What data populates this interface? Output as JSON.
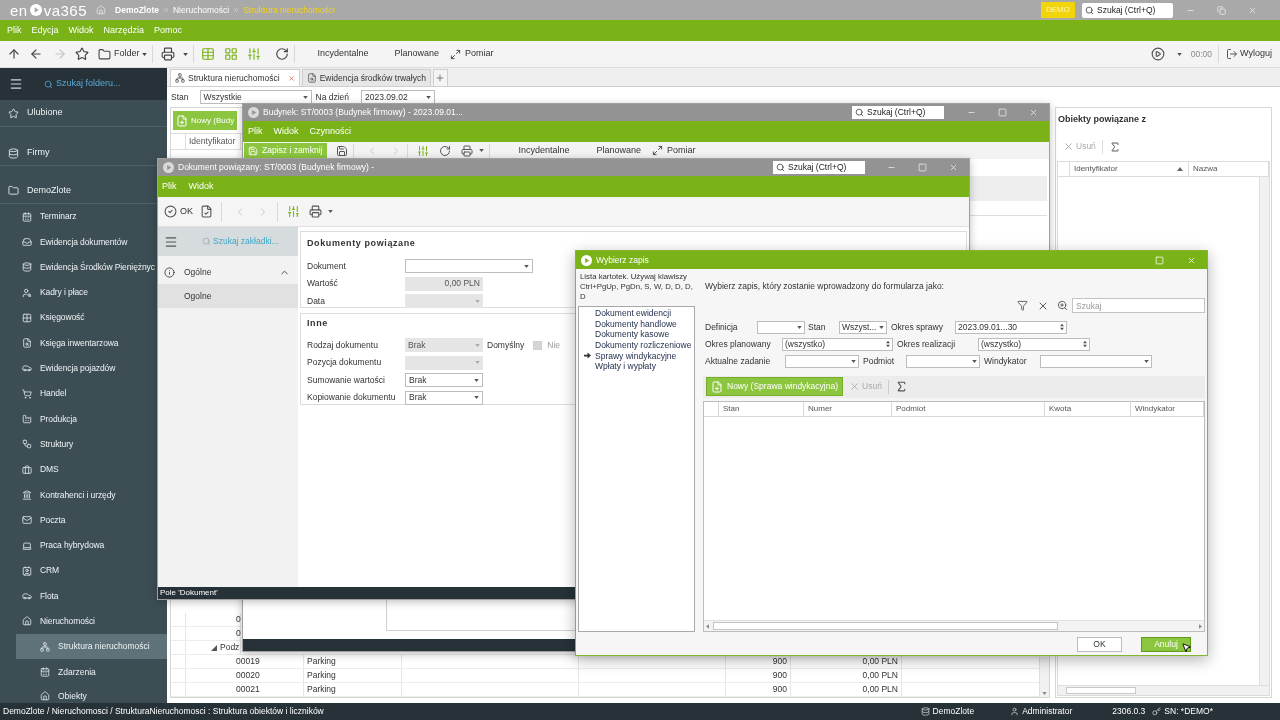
{
  "app_bar": {
    "logo": {
      "start": "en",
      "end": "va365"
    },
    "breadcrumb": [
      {
        "label": "DemoZlote",
        "current": false
      },
      {
        "label": "Nieruchomości",
        "current": false
      },
      {
        "label": "Struktura nieruchomości",
        "current": true
      }
    ],
    "badge": "DEMO",
    "search": {
      "placeholder": "Szukaj (Ctrl+Q)"
    }
  },
  "menu": [
    "Plik",
    "Edycja",
    "Widok",
    "Narzędzia",
    "Pomoc"
  ],
  "toolbar": {
    "history": [
      {
        "kind": "up",
        "disabled": false
      },
      {
        "kind": "back",
        "disabled": false
      },
      {
        "kind": "forward",
        "disabled": true
      }
    ],
    "folder": "Folder",
    "actions": [
      {
        "label": "Incydentalne",
        "kind": "text"
      },
      {
        "label": "Planowane",
        "kind": "text"
      },
      {
        "label": "Pomiar",
        "kind": "expand"
      }
    ],
    "timer": "00:00",
    "logout": "Wyloguj"
  },
  "sidebar": {
    "search": {
      "placeholder": "Szukaj folderu..."
    },
    "groups": [
      {
        "label": "Ulubione",
        "selected": false
      },
      {
        "label": "Firmy",
        "selected": false
      },
      {
        "label": "DemoZlote",
        "selected": false,
        "children": [
          {
            "label": "Terminarz",
            "selected": false
          },
          {
            "label": "Ewidencja dokumentów",
            "selected": false
          },
          {
            "label": "Ewidencja Środków Pieniężnyc",
            "selected": false
          },
          {
            "label": "Kadry i płace",
            "selected": false
          },
          {
            "label": "Księgowość",
            "selected": false
          },
          {
            "label": "Księga inwentarzowa",
            "selected": false
          },
          {
            "label": "Ewidencja pojazdów",
            "selected": false
          },
          {
            "label": "Handel",
            "selected": false
          },
          {
            "label": "Produkcja",
            "selected": false
          },
          {
            "label": "Struktury",
            "selected": false
          },
          {
            "label": "DMS",
            "selected": false
          },
          {
            "label": "Kontrahenci i urzędy",
            "selected": false
          },
          {
            "label": "Poczta",
            "selected": false
          },
          {
            "label": "Praca hybrydowa",
            "selected": false
          },
          {
            "label": "CRM",
            "selected": false
          },
          {
            "label": "Flota",
            "selected": false
          },
          {
            "label": "Nieruchomości",
            "selected": false,
            "children": [
              {
                "label": "Struktura nieruchomości",
                "selected": true
              },
              {
                "label": "Zdarzenia",
                "selected": false
              },
              {
                "label": "Obiekty",
                "selected": false
              }
            ]
          }
        ]
      }
    ]
  },
  "tabs": [
    {
      "label": "Struktura nieruchomości",
      "selected": true
    },
    {
      "label": "Ewidencja środków trwałych",
      "selected": false
    }
  ],
  "filter_bar": {
    "state_label": "Stan",
    "state_value": "Wszystkie",
    "date_label": "Na dzień",
    "date_value": "2023.09.02"
  },
  "list": {
    "new_button": "Nowy (Budy",
    "columns": [
      "Identyfikator"
    ],
    "rows": [
      {
        "kind": "stub",
        "identifier": "0"
      },
      {
        "kind": "stub",
        "identifier": "0"
      },
      {
        "kind": "group",
        "label": "Podz"
      },
      {
        "kind": "row",
        "identifier": "00019",
        "name": "Parking",
        "quantity": "900",
        "amount": "0,00 PLN"
      },
      {
        "kind": "row",
        "identifier": "00020",
        "name": "Parking",
        "quantity": "900",
        "amount": "0,00 PLN"
      },
      {
        "kind": "row",
        "identifier": "00021",
        "name": "Parking",
        "quantity": "900",
        "amount": "0,00 PLN"
      }
    ]
  },
  "related_panel": {
    "title": "Obiekty powiązane z",
    "delete_button": {
      "label": "Usuń",
      "disabled": true
    },
    "columns": [
      {
        "label": "Identyfikator",
        "sorted": true
      },
      {
        "label": "Nazwa",
        "sorted": false
      }
    ]
  },
  "building_window": {
    "title": "Budynek: ST/0003 (Budynek firmowy) - 2023.09.01...",
    "active": false,
    "search": {
      "placeholder": "Szukaj (Ctrl+Q)"
    },
    "menu": [
      "Plik",
      "Widok",
      "Czynności"
    ],
    "save_button": "Zapisz i zamknij",
    "record_nav": [
      {
        "kind": "previous",
        "disabled": true
      },
      {
        "kind": "next",
        "disabled": true
      }
    ],
    "actions": [
      {
        "label": "Incydentalne",
        "kind": "text"
      },
      {
        "label": "Planowane",
        "kind": "text"
      },
      {
        "label": "Pomiar",
        "kind": "expand"
      }
    ]
  },
  "document_window": {
    "title": "Dokument powiązany: ST/0003 (Budynek firmowy) -",
    "active": false,
    "search": {
      "placeholder": "Szukaj (Ctrl+Q)"
    },
    "menu": [
      "Plik",
      "Widok"
    ],
    "ok_button": "OK",
    "record_nav": [
      {
        "kind": "previous",
        "disabled": true
      },
      {
        "kind": "next",
        "disabled": true
      }
    ],
    "tab_search": {
      "placeholder": "Szukaj zakładki..."
    },
    "nav": [
      {
        "label": "Ogólne",
        "expanded": true,
        "children": [
          {
            "label": "Ogolne",
            "selected": true
          }
        ]
      }
    ],
    "sections": [
      {
        "title": "Dokumenty powiązane",
        "fields": [
          {
            "label": "Dokument",
            "kind": "select",
            "disabled": false
          },
          {
            "label": "Wartość",
            "kind": "amount",
            "value": "0,00 PLN",
            "disabled": true
          },
          {
            "label": "Data",
            "kind": "select",
            "disabled": true
          }
        ]
      },
      {
        "title": "Inne",
        "fields": [
          {
            "label": "Rodzaj dokumentu",
            "kind": "select",
            "value": "Brak",
            "disabled": true,
            "checkbox": {
              "label": "Domyślny",
              "checked": false,
              "disabled": true,
              "text": "Nie"
            }
          },
          {
            "label": "Pozycja dokumentu",
            "kind": "select",
            "disabled": true
          },
          {
            "label": "Sumowanie wartości",
            "kind": "select",
            "value": "Brak",
            "disabled": false
          },
          {
            "label": "Kopiowanie dokumentu",
            "kind": "select",
            "value": "Brak",
            "disabled": false
          }
        ]
      }
    ],
    "status": "Pole 'Dokument'"
  },
  "picker_dialog": {
    "title": "Wybierz zapis",
    "active": true,
    "hint": "Lista kartotek. Używaj klawiszy Ctrl+PgUp, PgDn, S, W, D, D, D, D",
    "lists": [
      {
        "label": "Dokument ewidencji",
        "selected": false
      },
      {
        "label": "Dokumenty handlowe",
        "selected": false
      },
      {
        "label": "Dokumenty kasowe",
        "selected": false
      },
      {
        "label": "Dokumenty rozliczeniowe",
        "selected": false
      },
      {
        "label": "Sprawy windykacyjne",
        "selected": true
      },
      {
        "label": "Wpłaty i wypłaty",
        "selected": false
      }
    ],
    "prompt": "Wybierz zapis, który zostanie wprowadzony do formularza jako:",
    "record_search": {
      "placeholder": "Szukaj"
    },
    "filter_rows": [
      [
        {
          "label": "Definicja",
          "kind": "select"
        },
        {
          "label": "Stan",
          "kind": "select",
          "value": "Wszyst..."
        },
        {
          "label": "Okres sprawy",
          "kind": "spin",
          "value": "2023.09.01...30"
        }
      ],
      [
        {
          "label": "Okres planowany",
          "kind": "spin",
          "value": "(wszystko)"
        },
        {
          "label": "Okres realizacji",
          "kind": "spin",
          "value": "(wszystko)"
        }
      ],
      [
        {
          "label": "Aktualne zadanie",
          "kind": "select"
        },
        {
          "label": "Podmiot",
          "kind": "select"
        },
        {
          "label": "Windykator",
          "kind": "select"
        }
      ]
    ],
    "new_button": "Nowy (Sprawa windykacyjna)",
    "delete_button": {
      "label": "Usuń",
      "disabled": true
    },
    "columns": [
      "Stan",
      "Numer",
      "Podmiot",
      "Kwota",
      "Windykator"
    ],
    "buttons": [
      {
        "label": "OK",
        "highlighted": false
      },
      {
        "label": "Anuluj",
        "highlighted": true
      }
    ]
  },
  "status_bar": {
    "path": "DemoZlote / Nieruchomosci / StrukturaNieruchomosci : Struktura obiektów i liczników",
    "database": "DemoZlote",
    "user": "Administrator",
    "version": "2306.0.3",
    "serial": "SN: *DEMO*"
  }
}
